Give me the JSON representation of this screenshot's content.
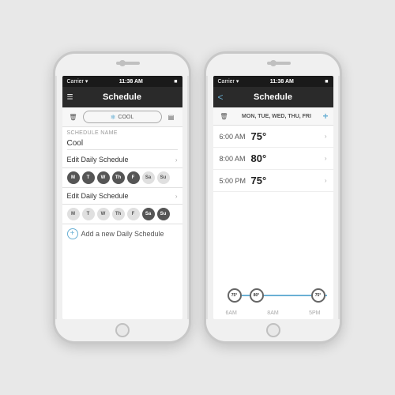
{
  "phone1": {
    "statusBar": {
      "carrier": "Carrier",
      "wifi": "WiFi",
      "time": "11:38 AM",
      "battery": "Battery"
    },
    "nav": {
      "title": "Schedule",
      "menuIcon": "☰",
      "trashIcon": "🗑"
    },
    "toolbar": {
      "trashLabel": "🗑",
      "coolLabel": "COOL",
      "calendarLabel": "📅"
    },
    "scheduleNameSection": {
      "label": "SCHEDULE NAME",
      "value": "Cool"
    },
    "editSchedule1": {
      "label": "Edit Daily Schedule"
    },
    "days1": [
      {
        "label": "M",
        "active": true
      },
      {
        "label": "T",
        "active": true
      },
      {
        "label": "W",
        "active": true
      },
      {
        "label": "Th",
        "active": true
      },
      {
        "label": "F",
        "active": true
      },
      {
        "label": "Sa",
        "active": false
      },
      {
        "label": "Su",
        "active": false
      }
    ],
    "editSchedule2": {
      "label": "Edit Daily Schedule"
    },
    "days2": [
      {
        "label": "M",
        "active": false
      },
      {
        "label": "T",
        "active": false
      },
      {
        "label": "W",
        "active": false
      },
      {
        "label": "Th",
        "active": false
      },
      {
        "label": "F",
        "active": false
      },
      {
        "label": "Sa",
        "active": true
      },
      {
        "label": "Su",
        "active": true
      }
    ],
    "addSchedule": {
      "label": "Add a new Daily Schedule"
    }
  },
  "phone2": {
    "statusBar": {
      "carrier": "Carrier",
      "wifi": "WiFi",
      "time": "11:38 AM",
      "battery": "Battery"
    },
    "nav": {
      "title": "Schedule",
      "backIcon": "<",
      "plusIcon": "+"
    },
    "toolbar": {
      "trashLabel": "🗑",
      "daysLabel": "MON, TUE, WED, THU, FRI",
      "plusLabel": "+"
    },
    "timeSlots": [
      {
        "time": "6:00 AM",
        "temp": "75°"
      },
      {
        "time": "8:00 AM",
        "temp": "80°"
      },
      {
        "time": "5:00 PM",
        "temp": "75°"
      }
    ],
    "slider": {
      "dot1Value": "75°",
      "dot1Left": 10,
      "dot2Value": "80°",
      "dot2Left": 38,
      "dot3Value": "75°",
      "dot3Left": 118,
      "fillLeft": 19,
      "fillWidth": 109,
      "labelLeft": "6AM",
      "labelMid": "8AM",
      "labelRight": "5PM"
    }
  }
}
